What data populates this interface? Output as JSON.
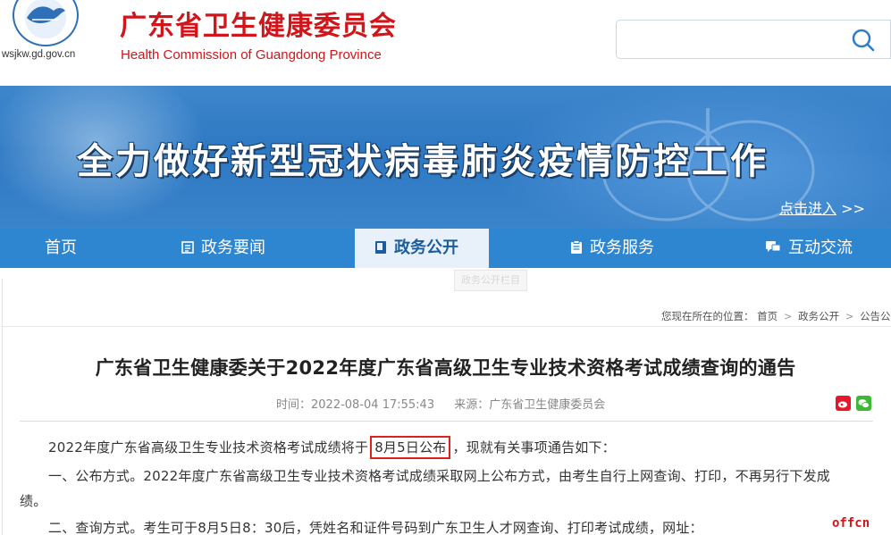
{
  "header": {
    "domain": "wsjkw.gd.gov.cn",
    "title_cn": "广东省卫生健康委员会",
    "title_en": "Health Commission of Guangdong Province",
    "search_placeholder": ""
  },
  "banner": {
    "headline": "全力做好新型冠状病毒肺炎疫情防控工作",
    "link_label": "点击进入",
    "link_arrows": ">>"
  },
  "nav": {
    "items": [
      {
        "label": "首页",
        "icon": ""
      },
      {
        "label": "政务要闻",
        "icon": "news-icon"
      },
      {
        "label": "政务公开",
        "icon": "book-icon"
      },
      {
        "label": "政务服务",
        "icon": "clipboard-icon"
      },
      {
        "label": "互动交流",
        "icon": "chat-icon"
      }
    ],
    "active_index": 2,
    "ghost_tip": "政务公开栏目"
  },
  "breadcrumb": {
    "prefix": "您现在所在的位置：",
    "items": [
      "首页",
      "政务公开",
      "公告公"
    ],
    "sep": ">"
  },
  "article": {
    "title": "广东省卫生健康委关于2022年度广东省高级卫生专业技术资格考试成绩查询的通告",
    "time_label": "时间：",
    "time": "2022-08-04 17:55:43",
    "source_label": "来源：",
    "source": "广东省卫生健康委员会",
    "p1_before": "2022年度广东省高级卫生专业技术资格考试成绩将于",
    "p1_highlight": "8月5日公布",
    "p1_after": "，现就有关事项通告如下：",
    "p2_line1": "一、公布方式。2022年度广东省高级卫生专业技术资格考试成绩采取网上公布方式，由考生自行上网查询、打印，不再另行下发成",
    "p2_line2": "绩。",
    "p3": "二、查询方式。考生可于8月5日8：30后，凭姓名和证件号码到广东卫生人才网查询、打印考试成绩，网址："
  },
  "watermark": "offcn",
  "colors": {
    "brand_red": "#d0161b",
    "nav_blue": "#2f86d0",
    "highlight_red": "#e0201c"
  }
}
